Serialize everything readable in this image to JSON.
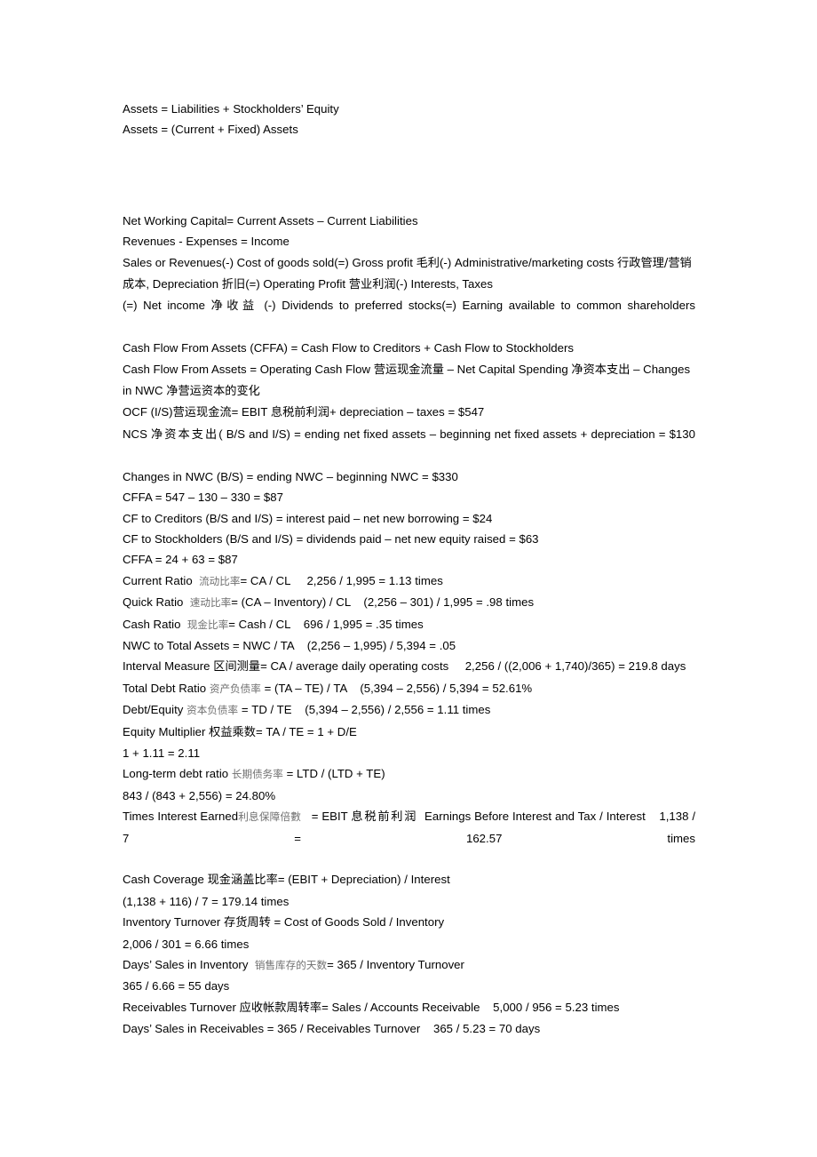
{
  "document": {
    "title": "Financial Formulas Notes",
    "page_background": "#ffffff",
    "text_color": "#000000",
    "muted_text_color": "#8f8f8f",
    "blocks": [
      {
        "id": "block-accounting-identity",
        "lines": [
          "Assets = Liabilities + Stockholders’ Equity",
          "Assets = (Current + Fixed) Assets"
        ]
      },
      {
        "id": "block-core-formulas",
        "lines": [
          "Net Working Capital= Current Assets – Current Liabilities",
          "Revenues - Expenses = Income"
        ]
      }
    ],
    "lines": {
      "assets_identity": "Assets = Liabilities + Stockholders’ Equity",
      "assets_composition": "Assets = (Current + Fixed) Assets",
      "net_working_capital": "Net Working Capital= Current Assets – Current Liabilities",
      "revenues_expenses": "Revenues - Expenses = Income",
      "income_statement_a": "Sales or Revenues(-) Cost of goods sold(=) Gross profit ",
      "income_statement_cn1": "毛利",
      "income_statement_b": "(-) Administrative/marketing costs ",
      "income_statement_cn2": "行政管理/营销成本",
      "income_statement_c": ", Depreciation ",
      "income_statement_cn3": "折旧",
      "income_statement_d": "(=) Operating Profit ",
      "income_statement_cn4": "营业利润",
      "income_statement_e": "(-) Interests, Taxes",
      "net_income_a": "(=) Net income ",
      "net_income_cn": "净收益",
      "net_income_b": " (-) Dividends to preferred stocks(=) Earning available to common shareholders",
      "cffa_definition": "Cash Flow From Assets (CFFA) = Cash Flow to Creditors + Cash Flow to Stockholders",
      "cffa_expanded_a": "Cash Flow From Assets = Operating Cash Flow ",
      "cffa_expanded_cn1": "营运现金流量",
      "cffa_expanded_b": " – Net Capital Spending ",
      "cffa_expanded_cn2": "净资本支出",
      "cffa_expanded_c": " – Changes in NWC ",
      "cffa_expanded_cn3": "净营运资本的变化",
      "ocf_a": "OCF (I/S)",
      "ocf_cn1": "营运现金流",
      "ocf_b": "= EBIT ",
      "ocf_cn2": "息税前利润",
      "ocf_c": "+ depreciation – taxes = $547",
      "ncs_a": "NCS ",
      "ncs_cn": "净资本支出",
      "ncs_b": "( B/S and I/S) = ending net fixed assets – beginning net fixed assets + depreciation = $130",
      "changes_nwc": "Changes in NWC (B/S) = ending NWC – beginning NWC = $330",
      "cffa_calc1": "CFFA = 547 – 130 – 330 = $87",
      "cf_creditors": "CF to Creditors (B/S and I/S) = interest paid – net new borrowing = $24",
      "cf_stockholders": "CF to Stockholders (B/S and I/S) = dividends paid – net new equity raised = $63",
      "cffa_calc2": "CFFA = 24 + 63 = $87",
      "current_ratio_a": "Current Ratio  ",
      "current_ratio_cn": "流动比率",
      "current_ratio_b": "= CA / CL     2,256 / 1,995 = 1.13 times",
      "quick_ratio_a": "Quick Ratio  ",
      "quick_ratio_cn": "速动比率",
      "quick_ratio_b": "= (CA – Inventory) / CL    (2,256 – 301) / 1,995 = .98 times",
      "cash_ratio_a": "Cash Ratio  ",
      "cash_ratio_cn": "现金比率",
      "cash_ratio_b": "= Cash / CL    696 / 1,995 = .35 times",
      "nwc_total_assets": "NWC to Total Assets = NWC / TA    (2,256 – 1,995) / 5,394 = .05",
      "interval_measure_a": "Interval Measure ",
      "interval_measure_cn": "区间测量",
      "interval_measure_b": "= CA / average daily operating costs     2,256 / ((2,006 + 1,740)/365) = 219.8 days",
      "total_debt_ratio_a": "Total Debt Ratio ",
      "total_debt_ratio_cn": "资产负债率",
      "total_debt_ratio_b": " = (TA – TE) / TA    (5,394 – 2,556) / 5,394 = 52.61%",
      "debt_equity_a": "Debt/Equity ",
      "debt_equity_cn": "资本负债率",
      "debt_equity_b": " = TD / TE    (5,394 – 2,556) / 2,556 = 1.11 times",
      "equity_multiplier_a": "Equity Multiplier ",
      "equity_multiplier_cn": "权益乘数",
      "equity_multiplier_b": "= TA / TE = 1 + D/E",
      "equity_multiplier_calc": "1 + 1.11 = 2.11",
      "ltd_ratio_a": "Long-term debt ratio ",
      "ltd_ratio_cn": "长期债务率",
      "ltd_ratio_b": " = LTD / (LTD + TE)",
      "ltd_ratio_calc": "843 / (843 + 2,556) = 24.80%",
      "tie_a": "Times Interest Earned",
      "tie_cn1": "利息保障倍數",
      "tie_b": "   = EBIT ",
      "tie_cn2": "息税前利润",
      "tie_c": "  Earnings Before Interest and Tax / Interest    1,138 / 7 = 162.57 times",
      "cash_coverage_a": "Cash Coverage ",
      "cash_coverage_cn": "现金涵盖比率",
      "cash_coverage_b": "= (EBIT + Depreciation) / Interest",
      "cash_coverage_calc": "(1,138 + 116) / 7 = 179.14 times",
      "inventory_turnover_a": "Inventory Turnover ",
      "inventory_turnover_cn": "存货周转",
      "inventory_turnover_b": " = Cost of Goods Sold / Inventory",
      "inventory_turnover_calc": "2,006 / 301 = 6.66 times",
      "days_sales_inventory_a": "Days’ Sales in Inventory  ",
      "days_sales_inventory_cn": "销售库存的天数",
      "days_sales_inventory_b": "= 365 / Inventory Turnover",
      "days_sales_inventory_calc": "365 / 6.66 = 55 days",
      "receivables_turnover_a": "Receivables Turnover ",
      "receivables_turnover_cn": "应收帐款周转率",
      "receivables_turnover_b": "= Sales / Accounts Receivable    5,000 / 956 = 5.23 times",
      "days_sales_receivables": "Days’ Sales in Receivables = 365 / Receivables Turnover    365 / 5.23 = 70 days"
    }
  }
}
